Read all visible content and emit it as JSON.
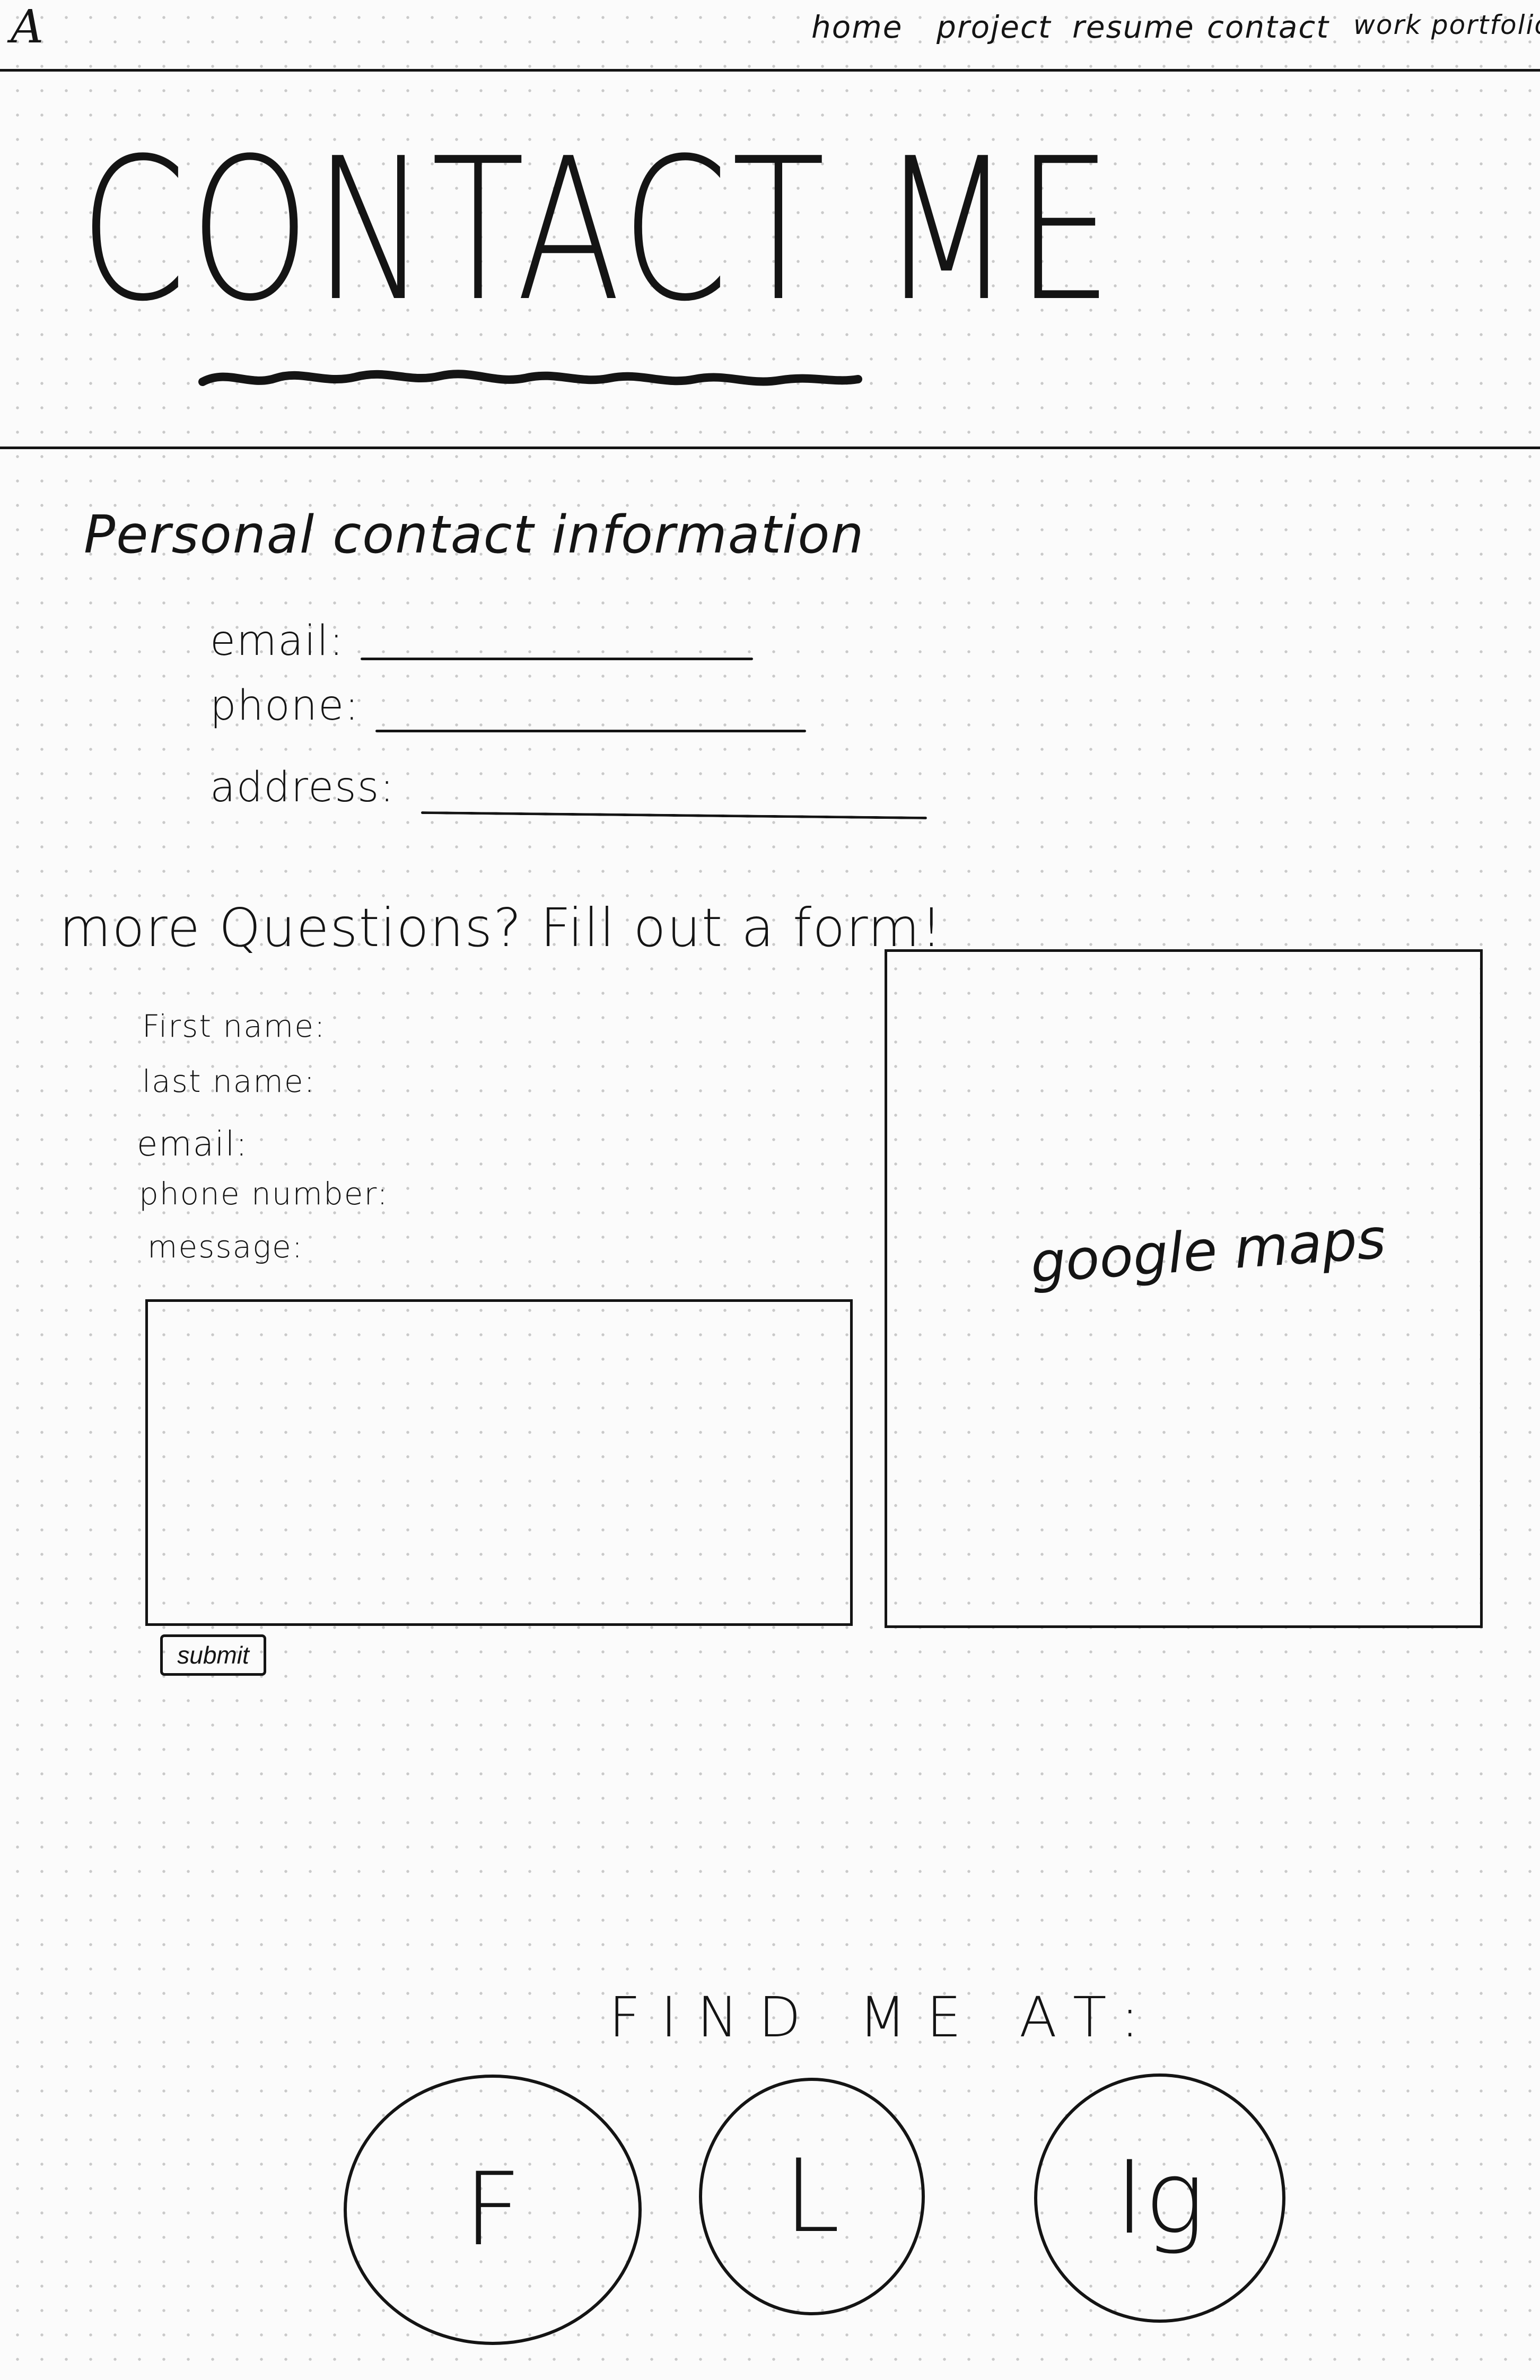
{
  "header": {
    "logo": "A",
    "nav": [
      "home",
      "project",
      "resume",
      "contact",
      "work portfolio"
    ]
  },
  "title": "CONTACT ME",
  "personal": {
    "heading": "Personal contact information",
    "fields": [
      {
        "label": "email:"
      },
      {
        "label": "phone:"
      },
      {
        "label": "address:"
      }
    ]
  },
  "form": {
    "heading": "more Questions? Fill out a form!",
    "labels": [
      "First name:",
      "last name:",
      "email:",
      "phone number:",
      "message:"
    ],
    "submit_label": "submit"
  },
  "map": {
    "label": "google maps"
  },
  "find": {
    "heading": "FIND ME AT:",
    "socials": [
      {
        "letter": "F",
        "icon": "facebook-icon"
      },
      {
        "letter": "L",
        "icon": "linkedin-icon"
      },
      {
        "letter": "Ig",
        "icon": "instagram-icon"
      }
    ]
  }
}
